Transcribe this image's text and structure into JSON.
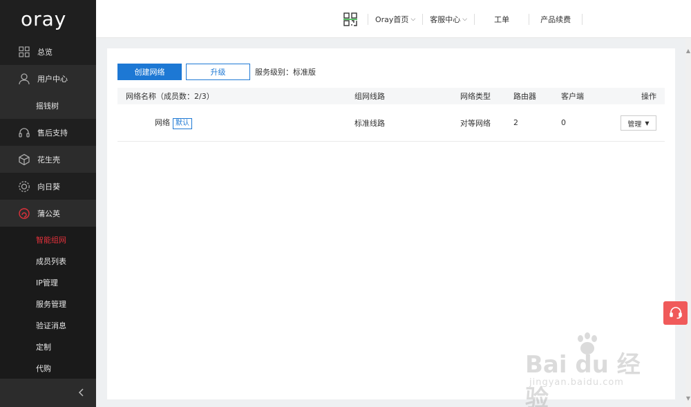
{
  "brand": {
    "logo_text": "oray"
  },
  "sidebar": {
    "items": [
      {
        "label": "总览",
        "icon": "grid-icon"
      },
      {
        "label": "用户中心",
        "icon": "user-icon"
      },
      {
        "label": "摇钱树",
        "icon": ""
      },
      {
        "label": "售后支持",
        "icon": "headset-icon"
      },
      {
        "label": "花生壳",
        "icon": "shell-icon"
      },
      {
        "label": "向日葵",
        "icon": "sunflower-icon"
      },
      {
        "label": "蒲公英",
        "icon": "dandelion-icon"
      }
    ],
    "sub_items": [
      {
        "label": "智能组网",
        "active": true
      },
      {
        "label": "成员列表",
        "active": false
      },
      {
        "label": "IP管理",
        "active": false
      },
      {
        "label": "服务管理",
        "active": false
      },
      {
        "label": "验证消息",
        "active": false
      },
      {
        "label": "定制",
        "active": false
      },
      {
        "label": "代购",
        "active": false
      }
    ],
    "collapse_icon": "chevron-left-icon"
  },
  "topbar": {
    "qr_icon": "qr-code-icon",
    "nav": [
      {
        "label": "Oray首页",
        "has_caret": true
      },
      {
        "label": "客服中心",
        "has_caret": true
      },
      {
        "label": "工单",
        "has_caret": false
      },
      {
        "label": "产品续费",
        "has_caret": false
      }
    ]
  },
  "toolbar": {
    "create_label": "创建网络",
    "upgrade_label": "升级",
    "service_level": "服务级别：标准版"
  },
  "table": {
    "headers": {
      "name": "网络名称（成员数：2/3）",
      "line": "组网线路",
      "type": "网络类型",
      "router": "路由器",
      "client": "客户端",
      "action": "操作"
    },
    "rows": [
      {
        "name": "网络",
        "badge": "默认",
        "line": "标准线路",
        "type": "对等网络",
        "router": "2",
        "client": "0",
        "action": "管理"
      }
    ]
  },
  "floating": {
    "support_icon": "headset-icon"
  },
  "watermark": {
    "main": "Bai du 经验",
    "sub": "jingyan.baidu.com"
  },
  "colors": {
    "primary": "#1d78d4",
    "accent_red": "#e0313b",
    "sidebar_bg": "#2c2c2c"
  }
}
